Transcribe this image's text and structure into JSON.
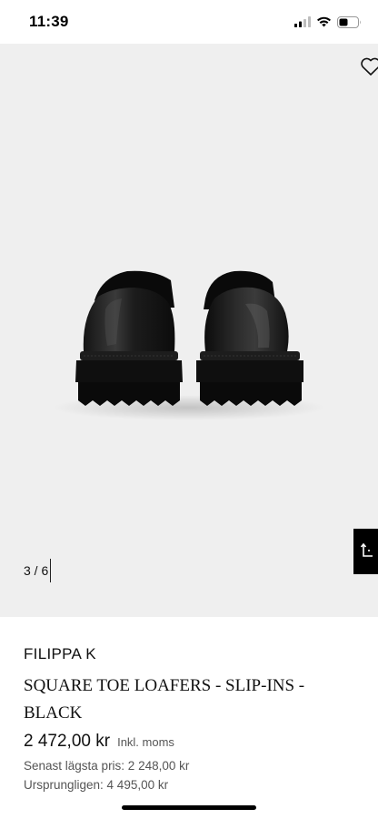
{
  "status_bar": {
    "time": "11:39",
    "icons": [
      "cellular-signal-icon",
      "wifi-icon",
      "battery-icon"
    ]
  },
  "gallery": {
    "image_alt": "Black leather square toe loafers, rear view",
    "counter": "3 / 6",
    "wishlist_icon": "heart-icon",
    "share_icon": "share-icon"
  },
  "product": {
    "brand": "FILIPPA K",
    "name": "SQUARE TOE LOAFERS - SLIP-INS - BLACK",
    "price": "2 472,00 kr",
    "price_note": "Inkl. moms",
    "lowest_price": "Senast lägsta pris: 2 248,00 kr",
    "original_price": "Ursprungligen: 4 495,00 kr"
  },
  "colors": {
    "gallery_background": "#efefef",
    "share_button": "#000000",
    "text_primary": "#111111",
    "text_secondary": "#555555"
  }
}
